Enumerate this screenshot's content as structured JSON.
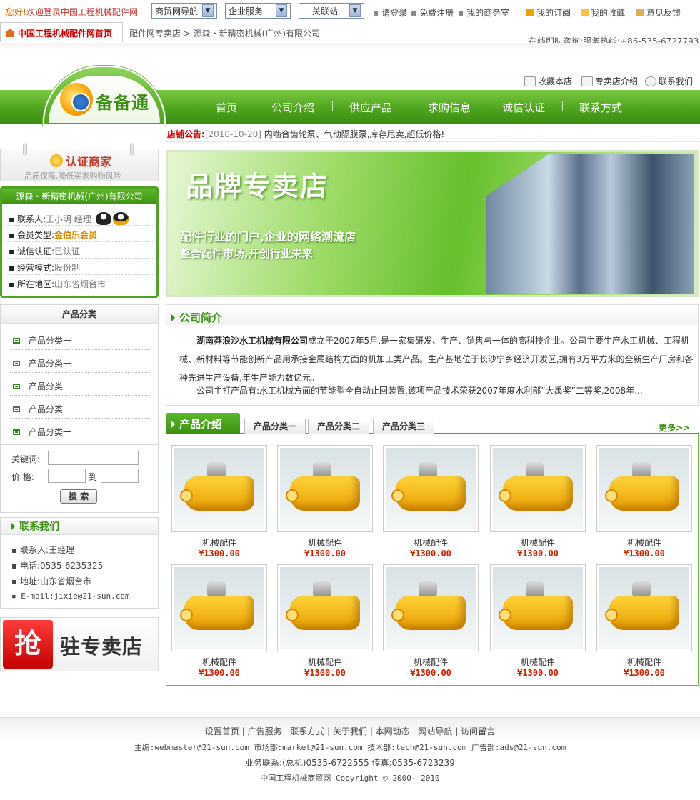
{
  "topbar": {
    "welcome_prefix": "您好!",
    "welcome_text": "欢迎登录中国工程机械配件网",
    "selects": [
      "商贸网导航",
      "企业服务",
      "关联站"
    ],
    "links": [
      "请登录",
      "免费注册",
      "我的商务室",
      "我的订阅",
      "我的收藏",
      "意见反馈"
    ]
  },
  "breadcrumb": {
    "home": "中国工程机械配件网首页",
    "trail": "配件网专卖店 > 源森・新精密机械(广州)有限公司",
    "hotline": "在线即时咨询:服务热线:+86-535-6727793"
  },
  "header_links": [
    "收藏本店",
    "专卖店介绍",
    "联系我们"
  ],
  "logo": {
    "text": "备备通"
  },
  "nav": [
    "首页",
    "公司介绍",
    "供应产品",
    "求购信息",
    "诚信认证",
    "联系方式"
  ],
  "notice": {
    "label": "店铺公告:",
    "date": "[2010-10-20]",
    "text": "内啮合齿轮泵、气动隔膜泵,库存甩卖,超低价格!"
  },
  "cert": {
    "title": "认证商家",
    "subtitle": "品质保障,降低买家购物风险"
  },
  "company": {
    "name": "源森・新精密机械(广州)有限公司",
    "rows": [
      {
        "k": "联系人:",
        "v": "王小明 经理"
      },
      {
        "k": "会员类型:",
        "v": "金伯乐会员"
      },
      {
        "k": "诚信认证:",
        "v": "已认证"
      },
      {
        "k": "经营模式:",
        "v": "股份制"
      },
      {
        "k": "所在地区:",
        "v": "山东省烟台市"
      }
    ]
  },
  "categories": {
    "title": "产品分类",
    "items": [
      "产品分类一",
      "产品分类一",
      "产品分类一",
      "产品分类一",
      "产品分类一"
    ]
  },
  "search": {
    "keyword_label": "关键词:",
    "price_label": "价 格:",
    "to_label": "到",
    "button": "搜 索"
  },
  "contact": {
    "title": "联系我们",
    "lines": [
      "联系人:王经理",
      "电话:0535-6235325",
      "地址:山东省烟台市",
      "E-mail:jixie@21-sun.com"
    ]
  },
  "grab_banner": {
    "char": "抢",
    "text": "驻专卖店"
  },
  "banner": {
    "title": "品牌专卖店",
    "line1": "配件行业的门户,企业的网络潮流店",
    "line2": "整合配件市场,开创行业未来"
  },
  "intro": {
    "title": "公司简介",
    "company": "湖南莽浪沙水工机械有限公司",
    "p1": "成立于2007年5月,是一家集研发、生产、销售与一体的高科技企业。公司主要生产水工机械、工程机械、新材料等节能创新产品用承接金属结构方面的机加工类产品。生产基地位于长沙宁乡经济开发区,拥有3万平方米的全新生产厂房和各种先进生产设备,年生产能力数亿元。",
    "p2": "公司主打产品有:水工机械方面的节能型全自动止回装置,该项产品技术荣获2007年度水利部“大禹奖”二等奖,2008年..."
  },
  "products": {
    "tab": "产品介绍",
    "subtabs": [
      "产品分类一",
      "产品分类二",
      "产品分类三"
    ],
    "more": "更多>>",
    "items": [
      {
        "name": "机械配件",
        "price": "¥1300.00"
      },
      {
        "name": "机械配件",
        "price": "¥1300.00"
      },
      {
        "name": "机械配件",
        "price": "¥1300.00"
      },
      {
        "name": "机械配件",
        "price": "¥1300.00"
      },
      {
        "name": "机械配件",
        "price": "¥1300.00"
      },
      {
        "name": "机械配件",
        "price": "¥1300.00"
      },
      {
        "name": "机械配件",
        "price": "¥1300.00"
      },
      {
        "name": "机械配件",
        "price": "¥1300.00"
      },
      {
        "name": "机械配件",
        "price": "¥1300.00"
      },
      {
        "name": "机械配件",
        "price": "¥1300.00"
      }
    ]
  },
  "footer": {
    "links": [
      "设置首页",
      "广告服务",
      "联系方式",
      "关于我们",
      "本网动态",
      "网站导航",
      "访问留言"
    ],
    "emails": "主编:webmaster@21-sun.com 市场部:market@21-sun.com 技术部:tech@21-sun.com 广告部:ads@21-sun.com",
    "phone": "业务联系:(总机)0535-6722555 传真:0535-6723239",
    "copyright": "中国工程机械商贸网 Copyright © 2000- 2010"
  }
}
